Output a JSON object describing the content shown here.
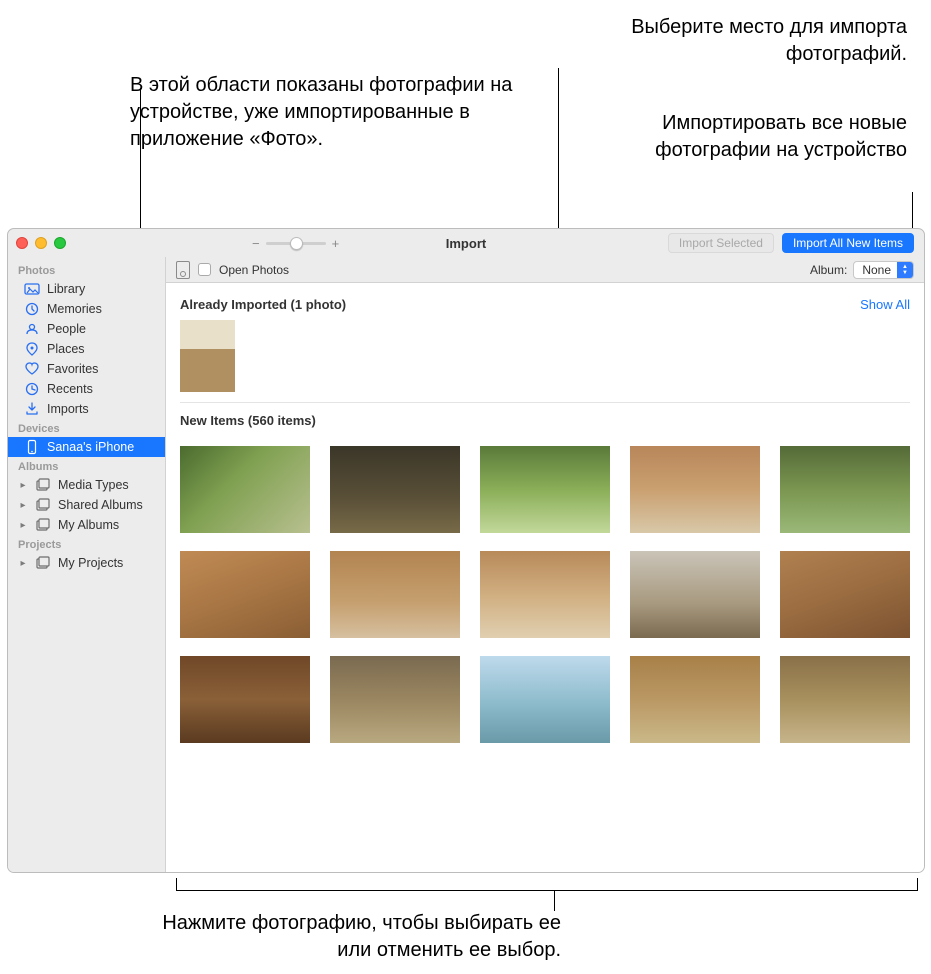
{
  "callouts": {
    "already": "В этой области показаны фотографии на устройстве, уже импортированные в приложение «Фото».",
    "album": "Выберите место для импорта фотографий.",
    "import_all": "Импортировать все новые фотографии на устройство",
    "select_photo": "Нажмите фотографию, чтобы выбирать ее или отменить ее выбор."
  },
  "window": {
    "title": "Import",
    "zoom": {
      "minus": "−",
      "plus": "+"
    },
    "buttons": {
      "import_selected": "Import Selected",
      "import_all": "Import All New Items"
    }
  },
  "optionbar": {
    "open_photos": "Open Photos",
    "album_label": "Album:",
    "album_value": "None"
  },
  "sidebar": {
    "photos_section": "Photos",
    "items": [
      {
        "label": "Library"
      },
      {
        "label": "Memories"
      },
      {
        "label": "People"
      },
      {
        "label": "Places"
      },
      {
        "label": "Favorites"
      },
      {
        "label": "Recents"
      },
      {
        "label": "Imports"
      }
    ],
    "devices_section": "Devices",
    "device": "Sanaa's iPhone",
    "albums_section": "Albums",
    "albums": [
      {
        "label": "Media Types"
      },
      {
        "label": "Shared Albums"
      },
      {
        "label": "My Albums"
      }
    ],
    "projects_section": "Projects",
    "projects": [
      {
        "label": "My Projects"
      }
    ]
  },
  "content": {
    "already_header": "Already Imported (1 photo)",
    "show_all": "Show All",
    "new_header": "New Items (560 items)"
  }
}
